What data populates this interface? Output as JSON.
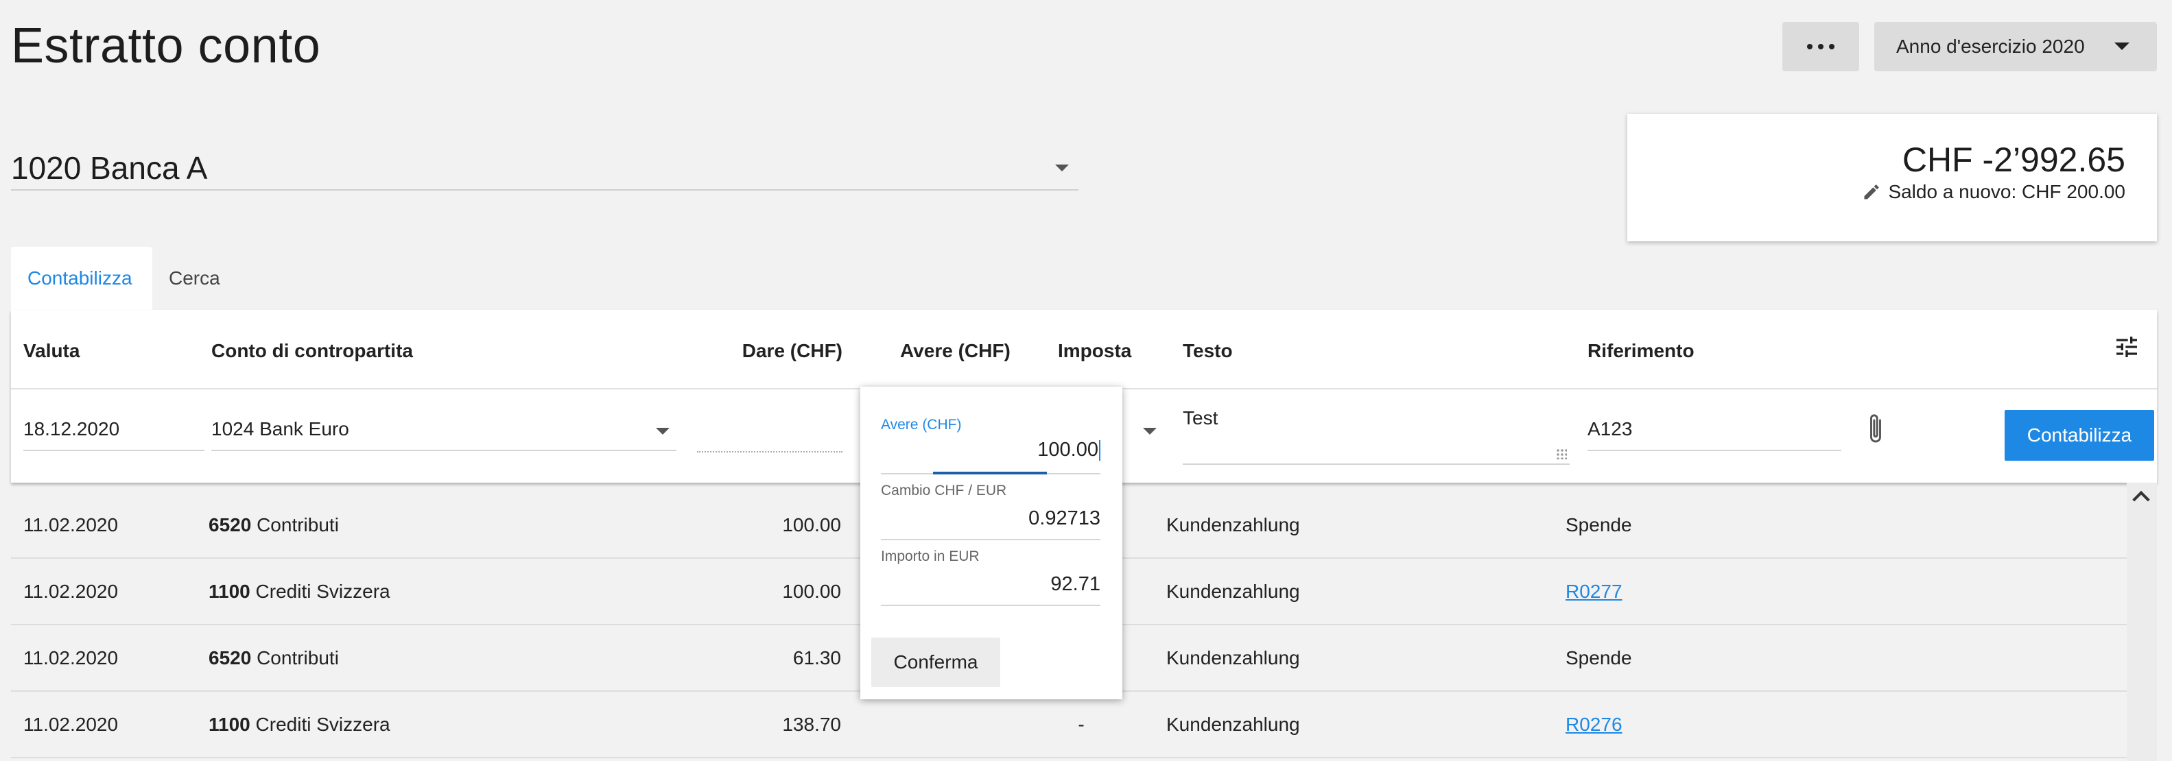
{
  "page": {
    "title": "Estratto conto"
  },
  "header": {
    "more_label": "...",
    "year_label": "Anno d'esercizio 2020"
  },
  "account": {
    "selected": "1020 Banca A"
  },
  "balance": {
    "amount": "CHF -2’992.65",
    "opening": "Saldo a nuovo: CHF 200.00"
  },
  "tabs": [
    {
      "label": "Contabilizza",
      "active": true
    },
    {
      "label": "Cerca",
      "active": false
    }
  ],
  "columns": {
    "date": "Valuta",
    "contra": "Conto di contropartita",
    "debit": "Dare (CHF)",
    "credit": "Avere (CHF)",
    "tax": "Imposta",
    "text": "Testo",
    "reference": "Riferimento"
  },
  "entry": {
    "date": "18.12.2020",
    "contra": "1024 Bank Euro",
    "text": "Test",
    "reference": "A123",
    "post_label": "Contabilizza"
  },
  "popover": {
    "credit_label": "Avere (CHF)",
    "credit_value": "100.00",
    "rate_label": "Cambio CHF / EUR",
    "rate_value": "0.92713",
    "amount_label": "Importo in EUR",
    "amount_value": "92.71",
    "confirm_label": "Conferma"
  },
  "rows": [
    {
      "date": "11.02.2020",
      "acct_no": "6520",
      "acct_name": "Contributi",
      "debit": "100.00",
      "tax": "",
      "text": "Kundenzahlung",
      "ref": "Spende",
      "ref_link": false
    },
    {
      "date": "11.02.2020",
      "acct_no": "1100",
      "acct_name": "Crediti Svizzera",
      "debit": "100.00",
      "tax": "",
      "text": "Kundenzahlung",
      "ref": "R0277",
      "ref_link": true
    },
    {
      "date": "11.02.2020",
      "acct_no": "6520",
      "acct_name": "Contributi",
      "debit": "61.30",
      "tax": "",
      "text": "Kundenzahlung",
      "ref": "Spende",
      "ref_link": false
    },
    {
      "date": "11.02.2020",
      "acct_no": "1100",
      "acct_name": "Crediti Svizzera",
      "debit": "138.70",
      "tax": "-",
      "text": "Kundenzahlung",
      "ref": "R0276",
      "ref_link": true
    }
  ],
  "colors": {
    "accent": "#1e88e5",
    "background": "#f2f2f2"
  }
}
